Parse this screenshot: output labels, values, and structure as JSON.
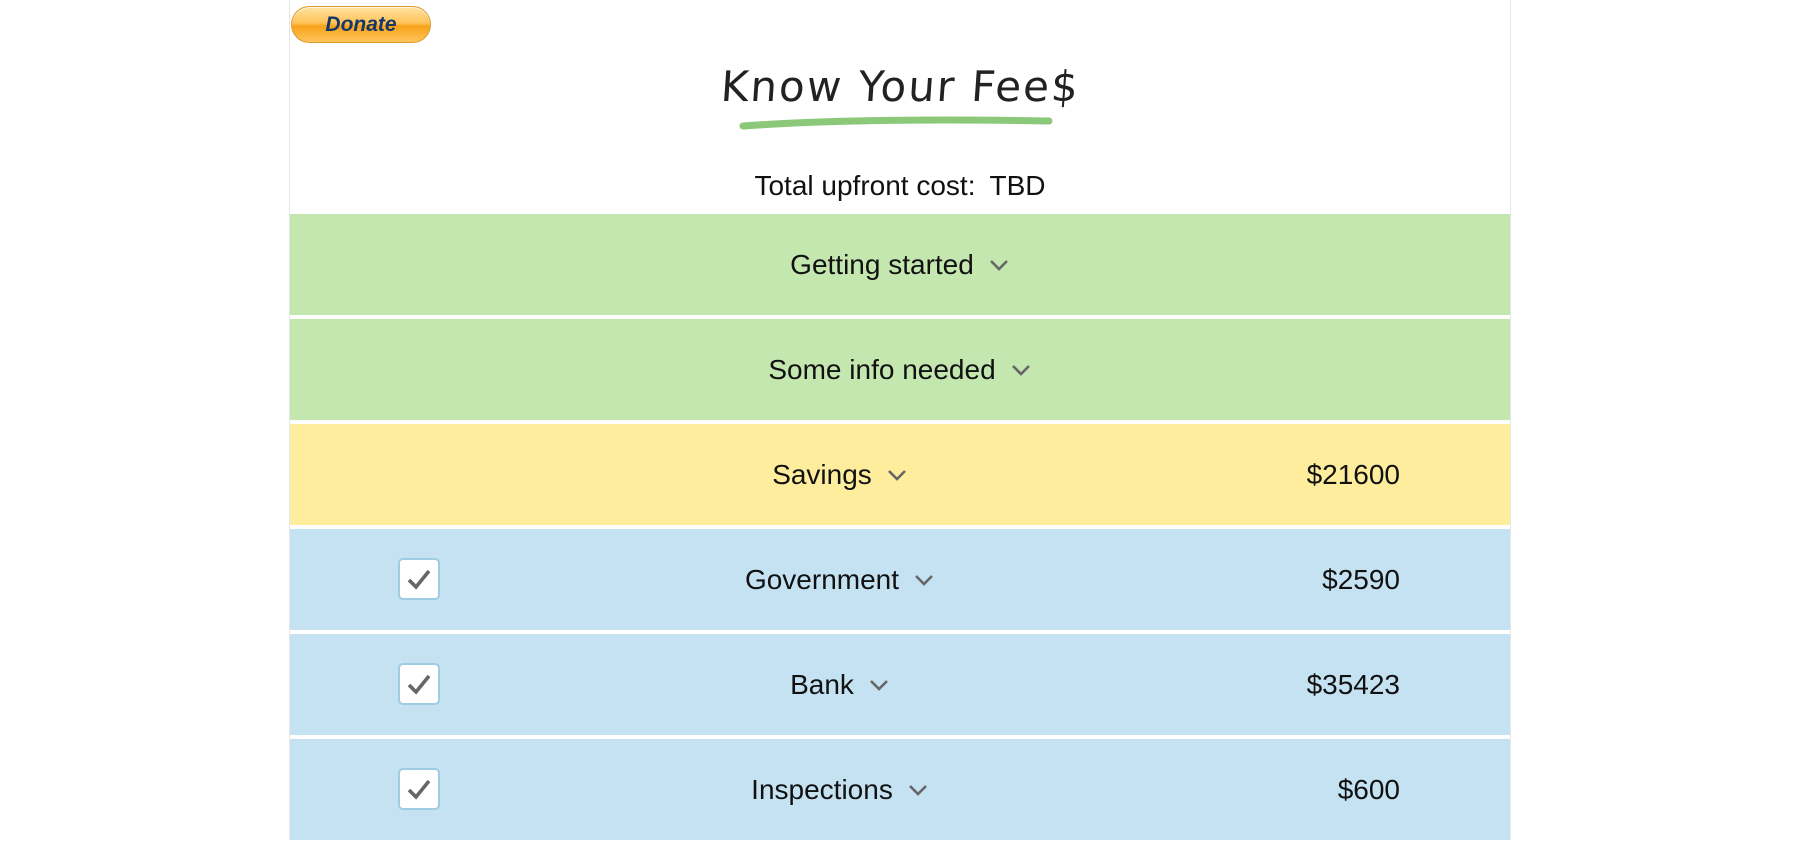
{
  "donate": {
    "label": "Donate"
  },
  "header": {
    "title": "Know Your Fee$"
  },
  "summary": {
    "label": "Total upfront cost:",
    "value": "TBD"
  },
  "sections": [
    {
      "label": "Getting started",
      "amount": "",
      "checked": null,
      "color": "#c4e7b0"
    },
    {
      "label": "Some info needed",
      "amount": "",
      "checked": null,
      "color": "#c4e7b0"
    },
    {
      "label": "Savings",
      "amount": "$21600",
      "checked": null,
      "color": "#feed9d"
    },
    {
      "label": "Government",
      "amount": "$2590",
      "checked": true,
      "color": "#c5e2f2"
    },
    {
      "label": "Bank",
      "amount": "$35423",
      "checked": true,
      "color": "#c5e2f2"
    },
    {
      "label": "Inspections",
      "amount": "$600",
      "checked": true,
      "color": "#c5e2f2"
    }
  ],
  "icons": {
    "chevron": "chevron-down-icon",
    "check": "check-icon"
  },
  "colors": {
    "accent_underline": "#8cc87a",
    "checkbox_border": "#9fcbe3",
    "donate_text": "#153866"
  }
}
